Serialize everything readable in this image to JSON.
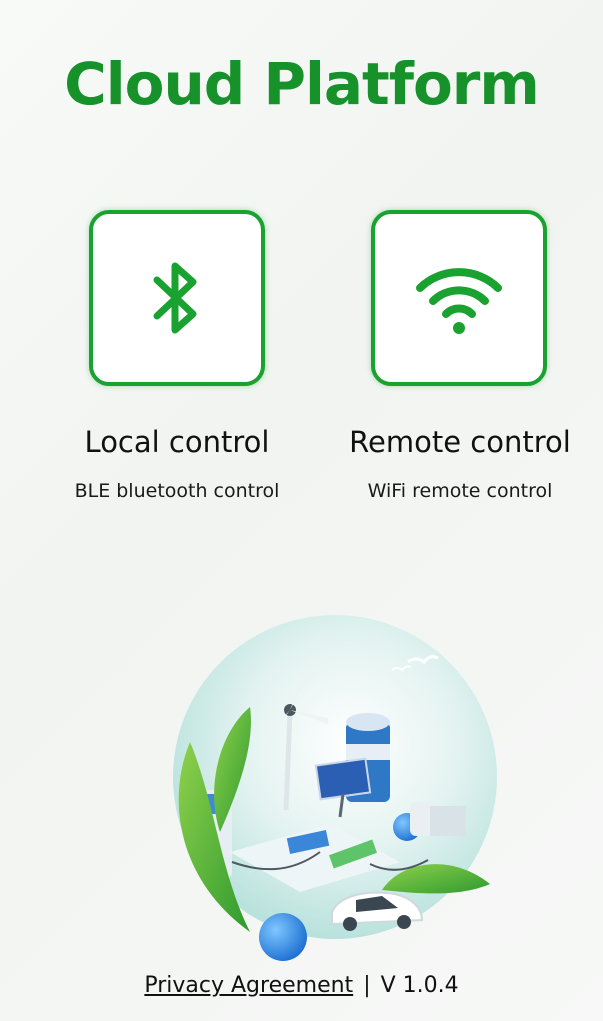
{
  "header": {
    "title": "Cloud Platform"
  },
  "modes": [
    {
      "label": "Local control",
      "subtitle": "BLE bluetooth control",
      "icon": "bluetooth-icon"
    },
    {
      "label": "Remote control",
      "subtitle": "WiFi remote control",
      "icon": "wifi-icon"
    }
  ],
  "footer": {
    "privacy_label": "Privacy Agreement",
    "separator": "|",
    "version": "V 1.0.4"
  },
  "colors": {
    "brand_green": "#17922b",
    "card_border": "#19a22f"
  }
}
